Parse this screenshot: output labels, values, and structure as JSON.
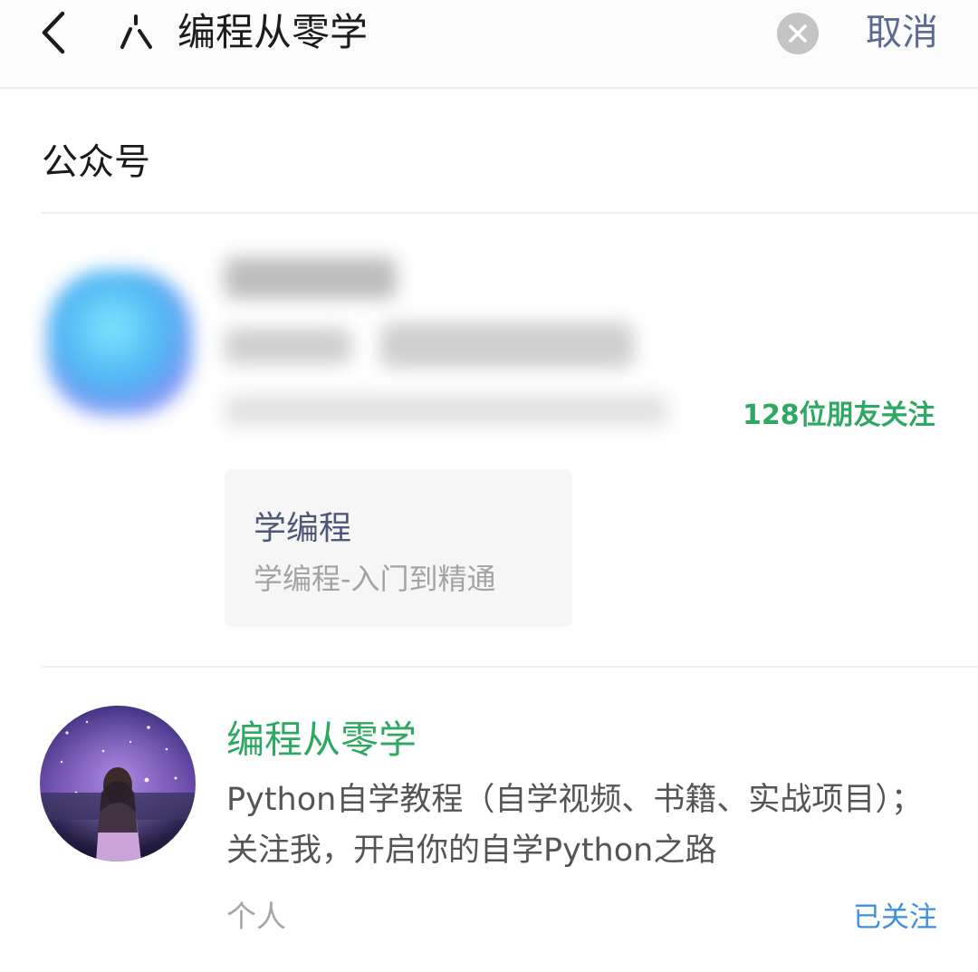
{
  "header": {
    "back_icon": "chevron-left-icon",
    "search_logo_icon": "weixin-search-icon",
    "query": "编程从零学",
    "clear_icon": "clear-circle-icon",
    "cancel_label": "取消"
  },
  "section": {
    "title": "公众号"
  },
  "results": [
    {
      "blurred": true,
      "friend_follow": "128位朋友关注",
      "subscription_card": {
        "title": "学编程",
        "desc": "学编程-入门到精通"
      }
    },
    {
      "name": "编程从零学",
      "description": "Python自学教程（自学视频、书籍、实战项目）；关注我，开启你的自学Python之路",
      "type": "个人",
      "follow_status": "已关注"
    }
  ],
  "colors": {
    "accent_green": "#2fa862",
    "link_blue": "#3d8fe0",
    "cancel_blue": "#5b6a91"
  }
}
